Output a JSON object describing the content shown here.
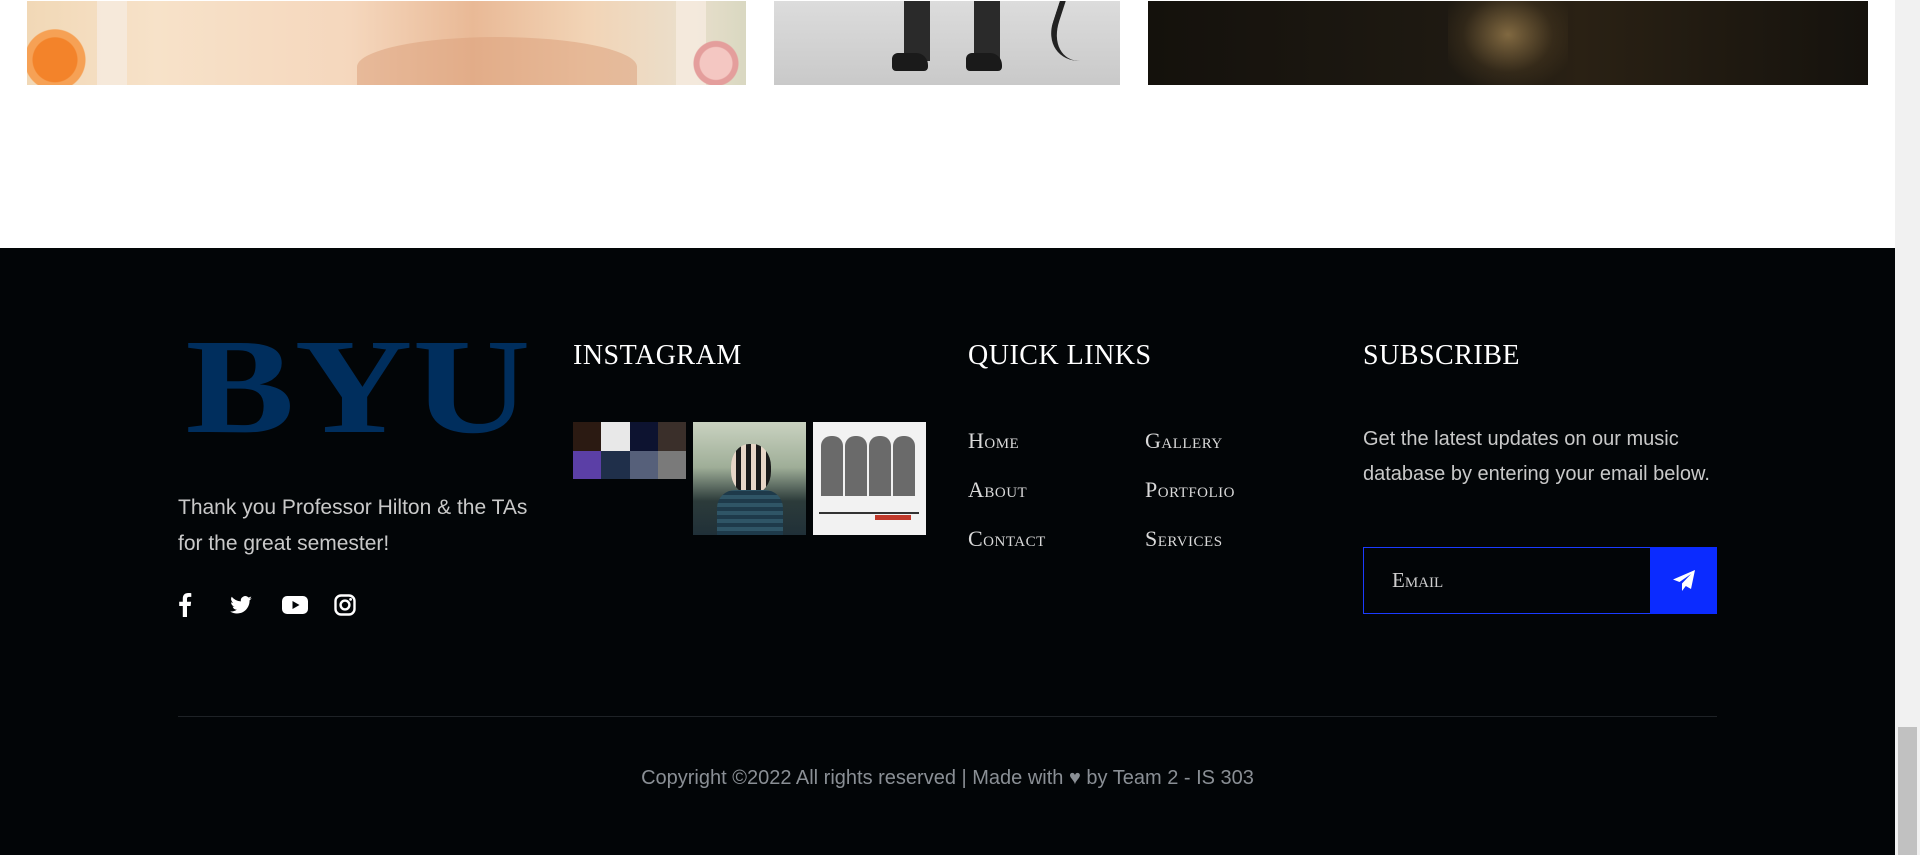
{
  "logo_text": "BYU",
  "brand_color": "#002E5D",
  "accent_color": "#0B2BFF",
  "footer": {
    "about_text": "Thank you Professor Hilton & the TAs for the great semester!",
    "socials": [
      {
        "icon": "facebook-icon"
      },
      {
        "icon": "twitter-icon"
      },
      {
        "icon": "youtube-icon"
      },
      {
        "icon": "instagram-icon"
      }
    ],
    "instagram": {
      "title": "INSTAGRAM"
    },
    "quick_links": {
      "title": "QUICK LINKS",
      "items": [
        "Home",
        "Gallery",
        "About",
        "Portfolio",
        "Contact",
        "Services"
      ]
    },
    "subscribe": {
      "title": "SUBSCRIBE",
      "text": "Get the latest updates on our music database by entering your email below.",
      "email_placeholder": "Email",
      "submit_icon": "paper-plane-icon"
    },
    "copyright": {
      "prefix": "Copyright ©2022 All rights reserved | Made with",
      "heart": "♥",
      "suffix": "by Team 2 - IS 303"
    }
  }
}
